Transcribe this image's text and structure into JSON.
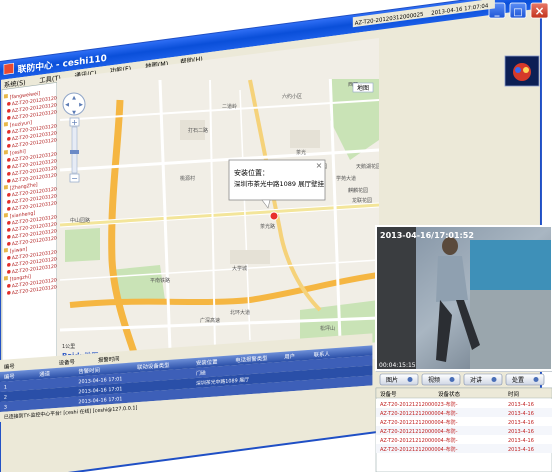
{
  "app": {
    "title": "联防中心 - ceshi110",
    "window_controls": {
      "minimize": "_",
      "maximize": "□",
      "close": "×"
    }
  },
  "status_bar": {
    "device_id": "AZ-T20-20120312000025",
    "datetime": "2013-04-16 17:07:04"
  },
  "menu": [
    {
      "label": "系统(S)"
    },
    {
      "label": "工具(T)"
    },
    {
      "label": "通讯(C)"
    },
    {
      "label": "功能(F)"
    },
    {
      "label": "地图(M)"
    },
    {
      "label": "帮助(H)"
    }
  ],
  "tabs": [
    {
      "label": "报警列表"
    },
    {
      "label": "告警查询"
    },
    {
      "label": "联防服务"
    },
    {
      "label": "日志查看"
    },
    {
      "label": "刷新地图"
    }
  ],
  "tree": {
    "groups": [
      {
        "label": "[fangweiwei]"
      },
      {
        "label": "[nuziyun]"
      },
      {
        "label": "[ceshi]"
      },
      {
        "label": "[ZhangZhe]"
      },
      {
        "label": "[xianheng]"
      },
      {
        "label": "[yiwan]"
      },
      {
        "label": "[tongzhi]"
      }
    ],
    "items": [
      {
        "label": "AZ-T20-2012031200"
      },
      {
        "label": "AZ-T20-2012031200"
      },
      {
        "label": "AZ-T20-2012031200"
      },
      {
        "label": "AZ-T20-2012031200"
      },
      {
        "label": "AZ-T20-2012031200"
      },
      {
        "label": "AZ-T20-2012031200"
      },
      {
        "label": "AZ-T20-2012031200"
      },
      {
        "label": "AZ-T20-2012031200"
      },
      {
        "label": "AZ-T20-2012031200"
      },
      {
        "label": "AZ-T20-2012031200"
      },
      {
        "label": "AZ-T20-2012031200"
      },
      {
        "label": "AZ-T20-2012031200"
      },
      {
        "label": "AZ-T20-2012031200"
      },
      {
        "label": "AZ-T20-2012031200"
      },
      {
        "label": "AZ-T20-2012031200"
      },
      {
        "label": "AZ-T20-2012031200"
      },
      {
        "label": "AZ-T20-2012031200"
      },
      {
        "label": "AZ-T20-2012031200"
      },
      {
        "label": "AZ-T20-2012031200"
      },
      {
        "label": "AZ-T20-2012031200"
      },
      {
        "label": "AZ-T20-2012031200"
      },
      {
        "label": "AZ-T20-2012031200"
      }
    ]
  },
  "map": {
    "popup": {
      "title": "安装位置：",
      "address": "深圳市茶光中路1089 展厅壁挂",
      "close": "×"
    },
    "labels": [
      {
        "text": "石鼓山公园"
      },
      {
        "text": "西丽"
      },
      {
        "text": "六约小区"
      },
      {
        "text": "二道岭"
      },
      {
        "text": "打石二路"
      },
      {
        "text": "茶光"
      },
      {
        "text": "高新科技园"
      },
      {
        "text": "学苑大道"
      },
      {
        "text": "麒麟花园"
      },
      {
        "text": "龙联花园"
      },
      {
        "text": "天鹅湖花园"
      },
      {
        "text": "中山园路"
      },
      {
        "text": "平南铁路"
      },
      {
        "text": "茶光路"
      },
      {
        "text": "广深高速"
      },
      {
        "text": "北环大道"
      },
      {
        "text": "松坪山"
      },
      {
        "text": "宝珠花园"
      },
      {
        "text": "桃源村"
      },
      {
        "text": "大学城"
      }
    ],
    "scale": "1公里",
    "watermark": "Baidu地图",
    "copyright": "© 2013 Baidu - Data © NavInfo",
    "nav": {
      "up": "▲",
      "down": "▼",
      "left": "◀",
      "right": "▶",
      "zoom_in": "+",
      "zoom_out": "−"
    },
    "map_type": "地图"
  },
  "video": {
    "timestamp": "2013-04-16/17:01:52",
    "counter": "00:04:15:15",
    "buttons": [
      {
        "label": "图片"
      },
      {
        "label": "视频"
      },
      {
        "label": "对讲"
      },
      {
        "label": "处置"
      }
    ]
  },
  "alarm_table": {
    "top_columns": [
      "编号",
      "设备号",
      "报警时间"
    ],
    "columns": [
      "编号",
      "通道",
      "告警时间",
      "联动设备类型",
      "安装位置",
      "电话报警类型",
      "用户",
      "联系人"
    ],
    "rows": [
      {
        "id": "1",
        "channel": "",
        "time": "2013-04-16 17:01",
        "type": "",
        "location": "门磁",
        "phone_type": "",
        "user": "",
        "contact": ""
      },
      {
        "id": "2",
        "channel": "",
        "time": "2013-04-16 17:01",
        "type": "",
        "location": "深圳茶光中路1089 展厅",
        "phone_type": "",
        "user": "",
        "contact": ""
      },
      {
        "id": "3",
        "channel": "",
        "time": "2013-04-16 17:01",
        "type": "",
        "location": "",
        "phone_type": "",
        "user": "",
        "contact": ""
      }
    ]
  },
  "device_table": {
    "columns": [
      "设备号",
      "设备状态",
      "时间"
    ],
    "rows": [
      {
        "device": "AZ-T20-20121212000023",
        "status": "-布防-",
        "time": "2013-4-16"
      },
      {
        "device": "AZ-T20-20121212000004",
        "status": "-布防-",
        "time": "2013-4-16"
      },
      {
        "device": "AZ-T20-20121212000004",
        "status": "-布防-",
        "time": "2013-4-16"
      },
      {
        "device": "AZ-T20-20121212000004",
        "status": "-布防-",
        "time": "2013-4-16"
      },
      {
        "device": "AZ-T20-20121212000004",
        "status": "-布防-",
        "time": "2013-4-16"
      },
      {
        "device": "AZ-T20-20121212000004",
        "status": "-布防-",
        "time": "2013-4-16"
      }
    ]
  },
  "bottom_status": "已连接到TY-监控中心平台! [ceshi 在线] [ceshi@127.0.0.1]"
}
